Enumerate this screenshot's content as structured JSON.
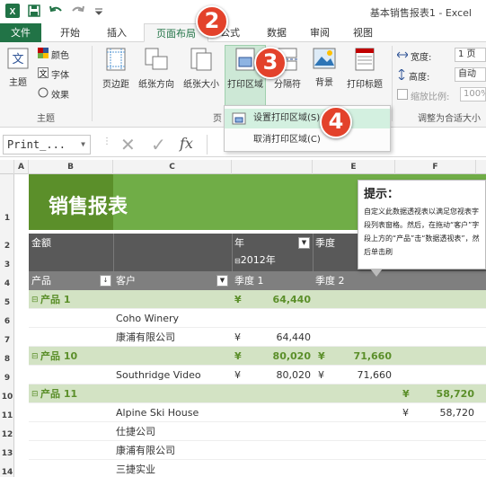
{
  "titlebar": {
    "title": "基本销售报表1 - Excel"
  },
  "tabs": [
    "文件",
    "开始",
    "插入",
    "页面布局",
    "公式",
    "数据",
    "审阅",
    "视图"
  ],
  "ribbon": {
    "theme": {
      "label": "主题",
      "colors": "颜色",
      "fonts": "字体",
      "effects": "效果",
      "group": "主题"
    },
    "margins": "页边距",
    "orientation": "纸张方向",
    "size": "纸张大小",
    "print_area": "打印区域",
    "breaks": "分隔符",
    "background": "背景",
    "print_titles": "打印标题",
    "page_setup_group": "页",
    "scale": {
      "width_label": "宽度:",
      "width_value": "1 页",
      "height_label": "高度:",
      "height_value": "自动",
      "zoom_label": "缩放比例:",
      "zoom_value": "100%",
      "group": "调整为合适大小"
    }
  },
  "menu": {
    "set": "设置打印区域(S)",
    "clear": "取消打印区域(C)"
  },
  "formula": {
    "namebox": "Print_...",
    "fx": "fx"
  },
  "columns": {
    "a": "A",
    "b": "B",
    "c": "C",
    "e": "E",
    "f": "F"
  },
  "rows": [
    "1",
    "2",
    "3",
    "4",
    "5",
    "6",
    "7",
    "8",
    "9",
    "10",
    "11",
    "12",
    "13",
    "14"
  ],
  "sheet": {
    "banner_title": "销售报表",
    "amount": "金额",
    "year": "年",
    "quarter": "季度",
    "year_value": "2012年",
    "q1": "季度 1",
    "q2": "季度 2",
    "product": "产品",
    "customer": "客户",
    "data_rows": [
      {
        "product": "产品 1",
        "group": true,
        "q1_sym": "¥",
        "q1": "64,440",
        "q2_sym": "",
        "q2": "",
        "q3_sym": "",
        "q3": ""
      },
      {
        "customer": "Coho Winery",
        "group": false,
        "q1_sym": "",
        "q1": "",
        "q2_sym": "",
        "q2": "",
        "q3_sym": "",
        "q3": ""
      },
      {
        "customer": "康浦有限公司",
        "group": false,
        "q1_sym": "¥",
        "q1": "64,440",
        "q2_sym": "",
        "q2": "",
        "q3_sym": "",
        "q3": ""
      },
      {
        "product": "产品 10",
        "group": true,
        "q1_sym": "¥",
        "q1": "80,020",
        "q2_sym": "¥",
        "q2": "71,660",
        "q3_sym": "",
        "q3": ""
      },
      {
        "customer": "Southridge Video",
        "group": false,
        "q1_sym": "¥",
        "q1": "80,020",
        "q2_sym": "¥",
        "q2": "71,660",
        "q3_sym": "",
        "q3": ""
      },
      {
        "product": "产品 11",
        "group": true,
        "q1_sym": "",
        "q1": "",
        "q2_sym": "",
        "q2": "",
        "q3_sym": "¥",
        "q3": "58,720"
      },
      {
        "customer": "Alpine Ski House",
        "group": false,
        "q1_sym": "",
        "q1": "",
        "q2_sym": "",
        "q2": "",
        "q3_sym": "¥",
        "q3": "58,720"
      },
      {
        "customer": "仕捷公司",
        "group": false,
        "q1_sym": "",
        "q1": "",
        "q2_sym": "",
        "q2": "",
        "q3_sym": "",
        "q3": ""
      },
      {
        "customer": "康浦有限公司",
        "group": false,
        "q1_sym": "",
        "q1": "",
        "q2_sym": "",
        "q2": "",
        "q3_sym": "",
        "q3": ""
      },
      {
        "customer": "三捷实业",
        "group": false,
        "q1_sym": "",
        "q1": "",
        "q2_sym": "",
        "q2": "",
        "q3_sym": "",
        "q3": ""
      }
    ]
  },
  "tooltip": {
    "title": "提示：",
    "body": "自定义此数据透视表以满足您视表字段列表窗格。然后，在拖动“客户”字段上方的“产品”击“数据透视表”，然后单击刷"
  },
  "badges": [
    "2",
    "3",
    "4"
  ],
  "colors": {
    "excel_green": "#217346",
    "banner_dark": "#5b8f2a",
    "banner_light": "#70ad47",
    "header_dark": "#595959",
    "group_row": "#d3e3c4"
  }
}
